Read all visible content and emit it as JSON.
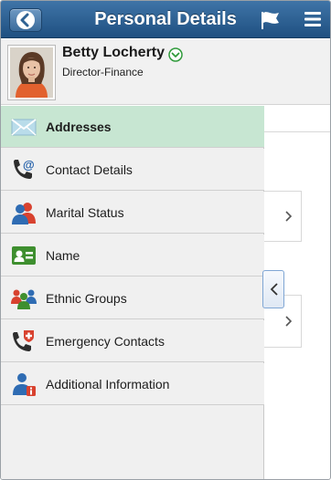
{
  "header": {
    "title": "Personal Details",
    "back_icon": "back-icon",
    "flag_icon": "flag-icon",
    "menu_icon": "hamburger-menu-icon"
  },
  "profile": {
    "name": "Betty Locherty",
    "job_title": "Director-Finance"
  },
  "sidebar": {
    "items": [
      {
        "label": "Addresses",
        "icon": "envelope-icon",
        "active": true
      },
      {
        "label": "Contact Details",
        "icon": "phone-email-icon",
        "active": false
      },
      {
        "label": "Marital Status",
        "icon": "couple-icon",
        "active": false
      },
      {
        "label": "Name",
        "icon": "id-card-icon",
        "active": false
      },
      {
        "label": "Ethnic Groups",
        "icon": "people-group-icon",
        "active": false
      },
      {
        "label": "Emergency Contacts",
        "icon": "emergency-phone-icon",
        "active": false
      },
      {
        "label": "Additional Information",
        "icon": "person-info-icon",
        "active": false
      }
    ]
  },
  "colors": {
    "header": "#2c5f91",
    "active_item": "#c7e6d2",
    "sidebar_bg": "#f0f0f0"
  }
}
